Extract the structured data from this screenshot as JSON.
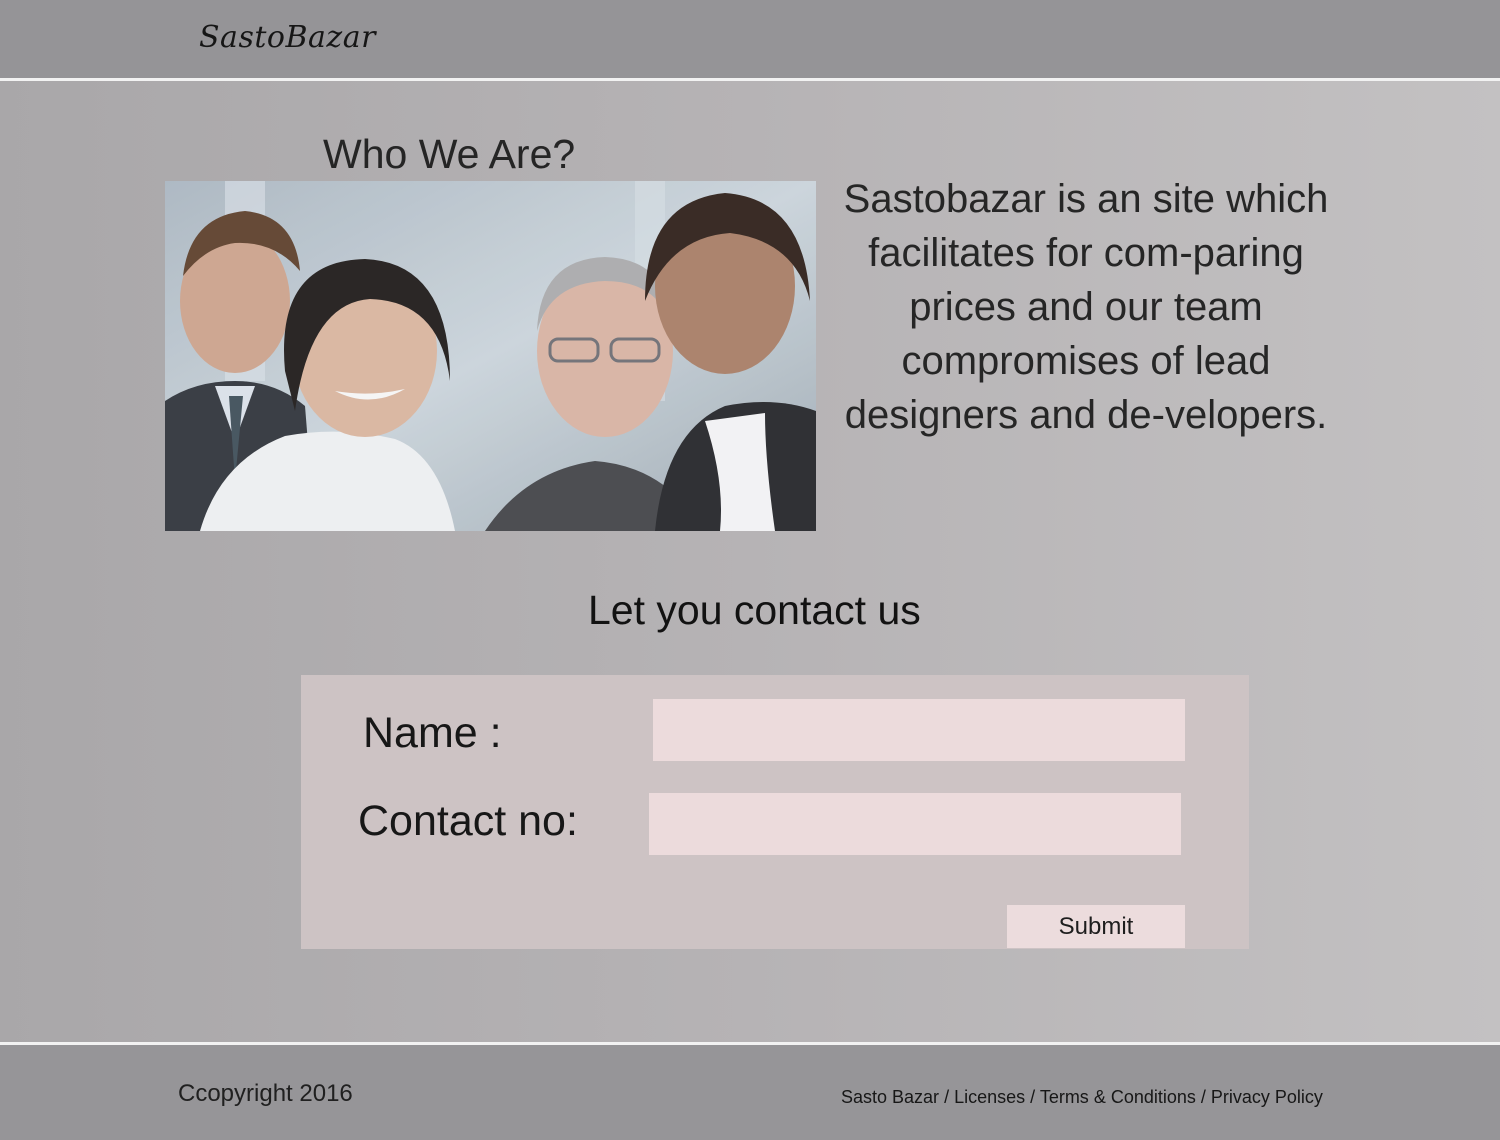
{
  "header": {
    "logo": "SastoBazar"
  },
  "about": {
    "heading": "Who We  Are?",
    "image_description": "team-photo",
    "text": "Sastobazar is an site which facilitates for com-paring prices and our team compromises of lead designers and de-velopers."
  },
  "contact": {
    "heading": "Let you contact us",
    "name_label": "Name :",
    "name_value": "",
    "contact_label": "Contact no:",
    "contact_value": "",
    "submit_label": "Submit"
  },
  "footer": {
    "copyright": "Ccopyright 2016",
    "links": [
      "Sasto Bazar",
      "Licenses",
      "Terms & Conditions",
      "Privacy Policy"
    ],
    "separator": " / "
  },
  "colors": {
    "header_bg": "#959497",
    "panel_bg": "#cdc3c4",
    "input_bg": "#ecdbdc"
  }
}
